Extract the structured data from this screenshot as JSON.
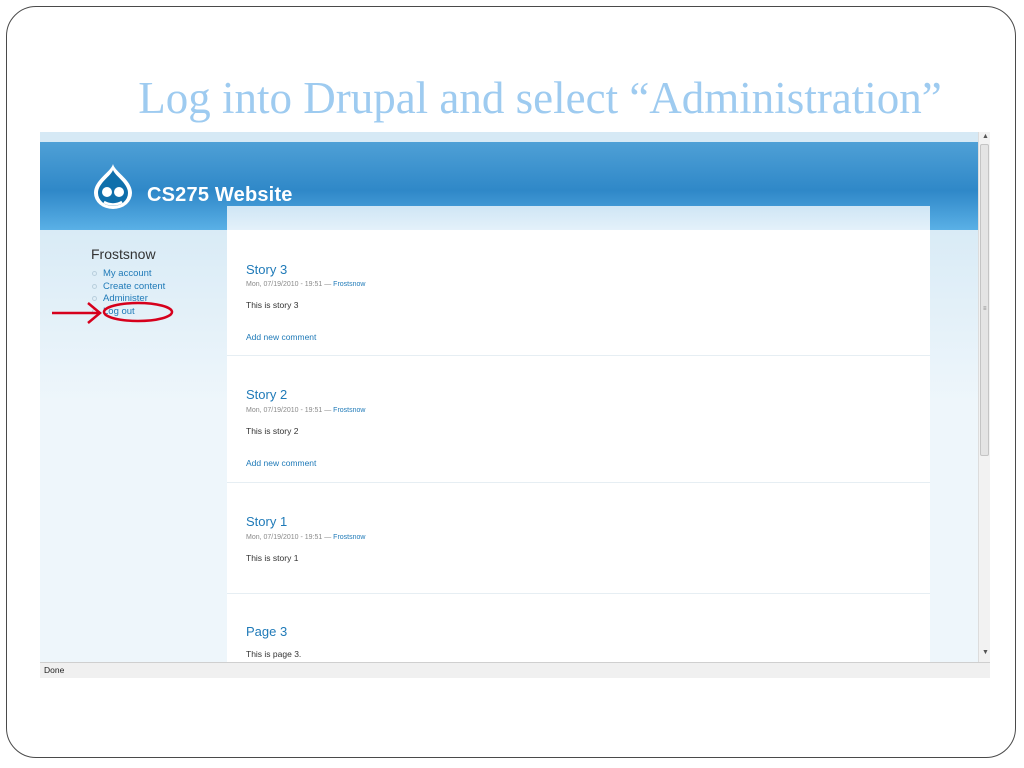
{
  "slide": {
    "title": "Log into Drupal and select “Administration”"
  },
  "site": {
    "name": "CS275 Website"
  },
  "sidebar": {
    "user_name": "Frostsnow",
    "menu": [
      {
        "label": "My account"
      },
      {
        "label": "Create content"
      },
      {
        "label": "Administer"
      },
      {
        "label": "Log out"
      }
    ]
  },
  "nodes": [
    {
      "title": "Story 3",
      "meta": "Mon, 07/19/2010 - 19:51 — ",
      "author": "Frostsnow",
      "body": "This is story 3",
      "link": "Add new comment"
    },
    {
      "title": "Story 2",
      "meta": "Mon, 07/19/2010 - 19:51 — ",
      "author": "Frostsnow",
      "body": "This is story 2",
      "link": "Add new comment"
    },
    {
      "title": "Story 1",
      "meta": "Mon, 07/19/2010 - 19:51 — ",
      "author": "Frostsnow",
      "body": "This is story 1"
    },
    {
      "title": "Page 3",
      "body": "This is page 3."
    }
  ],
  "browser": {
    "status": "Done"
  },
  "colors": {
    "accent": "#1f7ab8",
    "header": "#2f88c8",
    "title": "#9ecbf0",
    "annotation": "#d6001c"
  },
  "icons": [
    "drupal-logo-icon",
    "scroll-up-arrow-icon",
    "scroll-down-arrow-icon",
    "annotation-arrow-icon"
  ]
}
